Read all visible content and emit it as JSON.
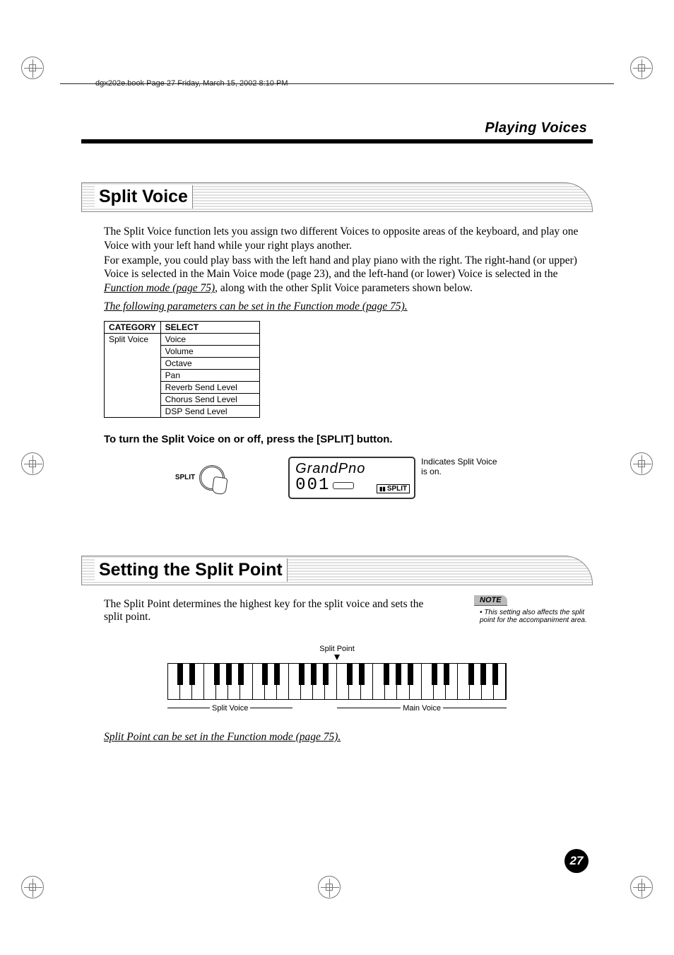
{
  "doc_header": "dgx202e.book  Page 27  Friday, March 15, 2002  8:10 PM",
  "chapter_title": "Playing Voices",
  "page_number": "27",
  "section1": {
    "title": "Split Voice",
    "para1": "The Split Voice function lets you assign two different Voices to opposite areas of the keyboard, and play one Voice with your left hand while your right plays another.",
    "para2a": "For example, you could play bass with the left hand and play piano with the right. The right-hand (or upper) Voice is selected in the Main Voice mode (page 23), and the left-hand (or lower) Voice is selected in the ",
    "para2_link": "Function mode (page 75)",
    "para2b": ", along with the other Split Voice parameters shown below.",
    "funcnote": "The following parameters can be set in the Function mode (page 75).",
    "table": {
      "h1": "CATEGORY",
      "h2": "SELECT",
      "cat": "Split Voice",
      "rows": [
        "Voice",
        "Volume",
        "Octave",
        "Pan",
        "Reverb Send Level",
        "Chorus Send Level",
        "DSP Send Level"
      ]
    },
    "instruction": "To turn the Split Voice on or off, press the [SPLIT] button.",
    "split_label": "SPLIT",
    "lcd_title": "GrandPno",
    "lcd_num": "001",
    "lcd_split_indicator": "SPLIT",
    "lcd_note": "Indicates Split Voice is on."
  },
  "section2": {
    "title": "Setting the Split Point",
    "para": "The Split Point determines the highest key for the split voice and sets the split point.",
    "note_label": "NOTE",
    "note_text": "This setting also affects the split point for the accompaniment area.",
    "split_point": "Split Point",
    "left_label": "Split Voice",
    "right_label": "Main Voice",
    "footer_link": "Split Point can be set in the Function mode (page 75)."
  }
}
